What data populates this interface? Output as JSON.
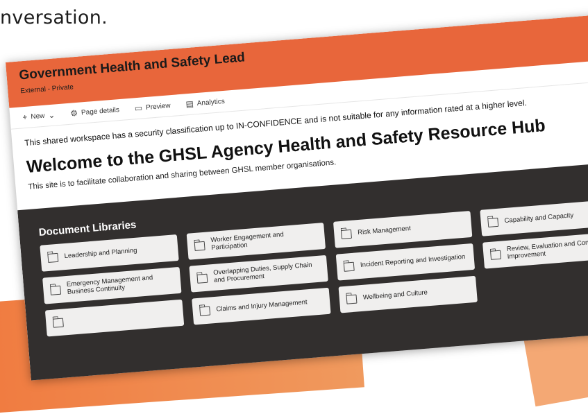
{
  "caption": "nversation.",
  "site": {
    "title": "Government Health and Safety Lead",
    "classification": "External - Private"
  },
  "commandbar": {
    "new_label": "New",
    "page_details_label": "Page details",
    "preview_label": "Preview",
    "analytics_label": "Analytics"
  },
  "content": {
    "notice": "This shared workspace has a security classification up to IN-CONFIDENCE and is not suitable for any information rated at a higher level.",
    "welcome": "Welcome to the GHSL Agency Health and Safety Resource Hub",
    "purpose": "This site is to facilitate collaboration and sharing between GHSL member organisations."
  },
  "libraries": {
    "title": "Document Libraries",
    "tiles": [
      "Leadership and Planning",
      "Worker Engagement and Participation",
      "Risk Management",
      "Capability and Capacity",
      "Emergency Management and Business Continuity",
      "Overlapping Duties, Supply Chain and Procurement",
      "Incident Reporting and Investigation",
      "Review, Evaluation and Continuous Improvement",
      "",
      "Claims and Injury Management",
      "Wellbeing and Culture",
      ""
    ]
  }
}
